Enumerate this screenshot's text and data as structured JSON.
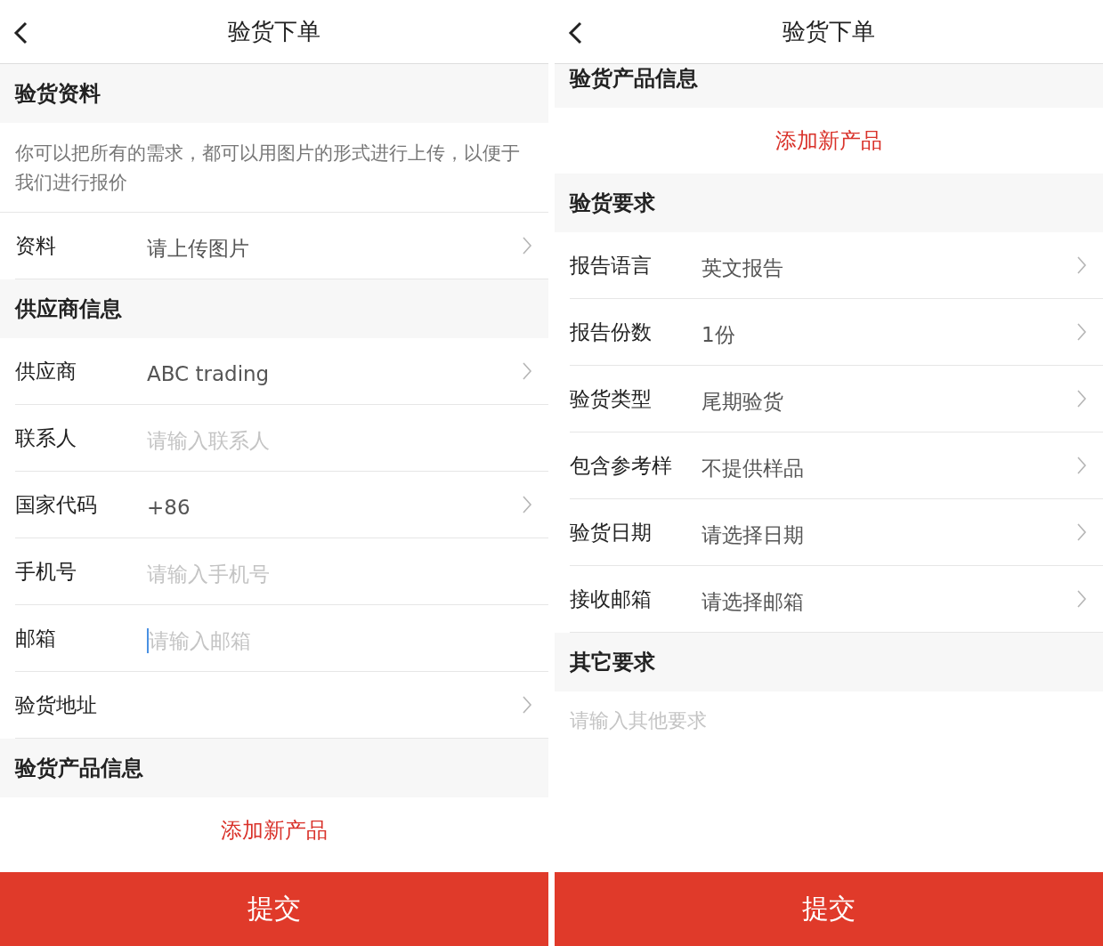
{
  "screens": [
    {
      "title": "验货下单",
      "items": [
        {
          "kind": "heading",
          "text": "验货资料",
          "clipped": false
        },
        {
          "kind": "note",
          "text": "你可以把所有的需求，都可以用图片的形式进行上传，以便于我们进行报价"
        },
        {
          "kind": "select",
          "label": "资料",
          "value": "请上传图片"
        },
        {
          "kind": "heading",
          "text": "供应商信息",
          "clipped": false
        },
        {
          "kind": "select",
          "label": "供应商",
          "value": "ABC trading"
        },
        {
          "kind": "input",
          "label": "联系人",
          "placeholder": "请输入联系人",
          "focused": false
        },
        {
          "kind": "select",
          "label": "国家代码",
          "value": "+86"
        },
        {
          "kind": "input",
          "label": "手机号",
          "placeholder": "请输入手机号",
          "focused": false
        },
        {
          "kind": "input",
          "label": "邮箱",
          "placeholder": "请输入邮箱",
          "focused": true
        },
        {
          "kind": "select",
          "label": "验货地址"
        },
        {
          "kind": "heading",
          "text": "验货产品信息",
          "clipped": false
        },
        {
          "kind": "add",
          "text": "添加新产品"
        }
      ],
      "submit": "提交"
    },
    {
      "title": "验货下单",
      "items": [
        {
          "kind": "heading",
          "text": "验货产品信息",
          "clipped": true
        },
        {
          "kind": "add",
          "text": "添加新产品"
        },
        {
          "kind": "heading",
          "text": "验货要求",
          "clipped": false
        },
        {
          "kind": "select",
          "label": "报告语言",
          "value": "英文报告"
        },
        {
          "kind": "select",
          "label": "报告份数",
          "value": "1份"
        },
        {
          "kind": "select",
          "label": "验货类型",
          "value": "尾期验货"
        },
        {
          "kind": "select",
          "label": "包含参考样",
          "value": "不提供样品"
        },
        {
          "kind": "select",
          "label": "验货日期",
          "value": "请选择日期"
        },
        {
          "kind": "select",
          "label": "接收邮箱",
          "value": "请选择邮箱"
        },
        {
          "kind": "heading",
          "text": "其它要求",
          "clipped": false
        },
        {
          "kind": "textarea",
          "placeholder": "请输入其他要求"
        }
      ],
      "submit": "提交"
    }
  ]
}
